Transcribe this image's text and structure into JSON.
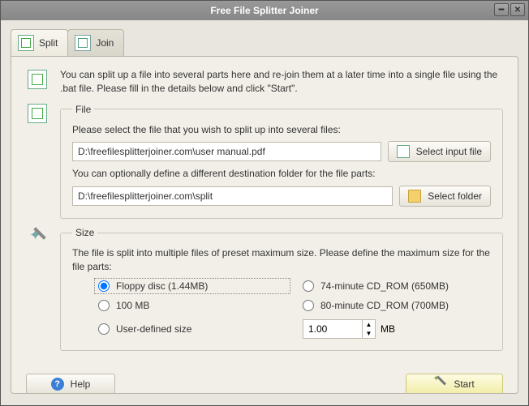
{
  "title": "Free File Splitter Joiner",
  "tabs": {
    "split": "Split",
    "join": "Join"
  },
  "intro": "You can split up a file into several parts here and re-join them at a later time into a single file using the .bat file. Please fill in the details below and click \"Start\".",
  "file": {
    "legend": "File",
    "select_label": "Please select the file that you wish to split up into several files:",
    "input_path": "D:\\freefilesplitterjoiner.com\\user manual.pdf",
    "select_btn": "Select input file",
    "dest_label": "You can optionally define a different destination folder for the file parts:",
    "dest_path": "D:\\freefilesplitterjoiner.com\\split",
    "dest_btn": "Select folder"
  },
  "size": {
    "legend": "Size",
    "desc": "The file is split into multiple files of preset maximum size. Please define the maximum size for the file parts:",
    "opt_floppy": "Floppy disc (1.44MB)",
    "opt_100": "100 MB",
    "opt_user": "User-defined size",
    "opt_74": "74-minute CD_ROM (650MB)",
    "opt_80": "80-minute CD_ROM (700MB)",
    "custom_value": "1.00",
    "custom_unit": "MB"
  },
  "footer": {
    "help": "Help",
    "start": "Start"
  }
}
